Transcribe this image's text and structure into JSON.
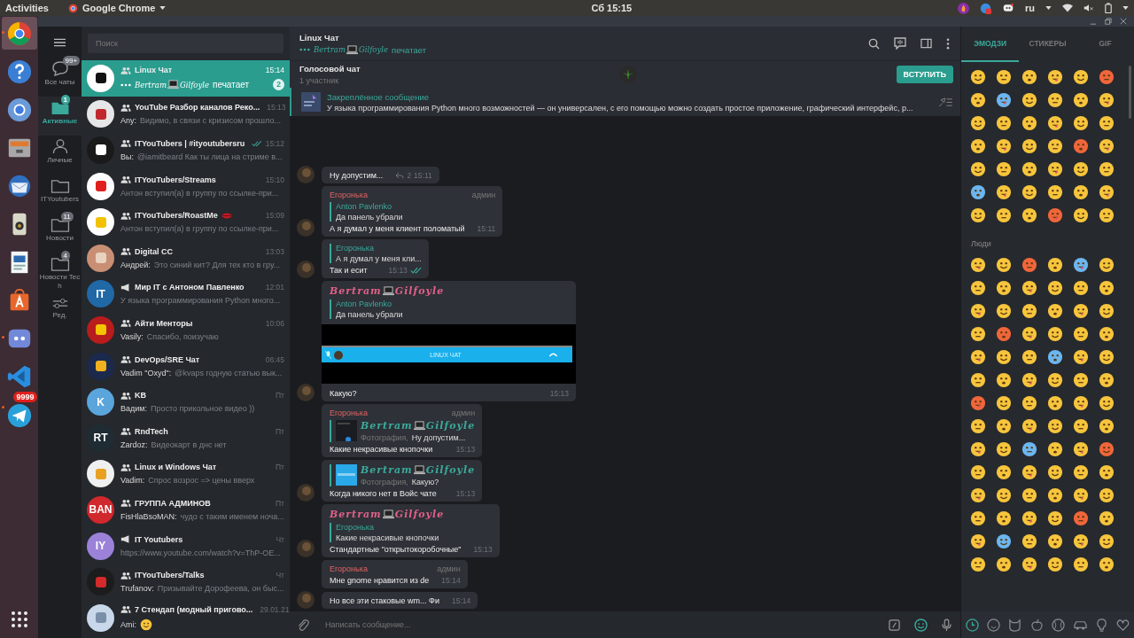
{
  "topbar": {
    "activities": "Activities",
    "app": "Google Chrome",
    "clock": "Сб 15:15",
    "lang": "ru"
  },
  "dock": {
    "items": [
      {
        "kind": "chrome",
        "selected": true,
        "running": true
      },
      {
        "kind": "help",
        "selected": false,
        "running": false
      },
      {
        "kind": "chromium",
        "selected": false,
        "running": false
      },
      {
        "kind": "files",
        "selected": false,
        "running": false
      },
      {
        "kind": "mail",
        "selected": false,
        "running": false
      },
      {
        "kind": "speaker",
        "selected": false,
        "running": false
      },
      {
        "kind": "writer",
        "selected": false,
        "running": false
      },
      {
        "kind": "store",
        "selected": false,
        "running": false
      },
      {
        "kind": "discord",
        "selected": false,
        "running": true
      },
      {
        "kind": "code",
        "selected": false,
        "running": false
      },
      {
        "kind": "telegram",
        "selected": false,
        "running": true,
        "badge": "9999"
      }
    ]
  },
  "folders": [
    {
      "kind": "chats",
      "label": "Все чаты",
      "badge": "99+",
      "selected": false
    },
    {
      "kind": "active",
      "label": "Активные",
      "badge": "1",
      "selected": true
    },
    {
      "kind": "person",
      "label": "Личные",
      "selected": false
    },
    {
      "kind": "folder",
      "label": "ITYoutubers",
      "selected": false
    },
    {
      "kind": "folder",
      "label": "Новости",
      "badge": "11",
      "selected": false
    },
    {
      "kind": "folder",
      "label": "Новости Tech",
      "badge": "4",
      "selected": false
    },
    {
      "kind": "edit",
      "label": "Ред.",
      "selected": false
    }
  ],
  "search": {
    "placeholder": "Поиск"
  },
  "chats": [
    {
      "kind": "group",
      "name": "Linux Чат",
      "time": "15:14",
      "selected": true,
      "read": false,
      "unread": "2",
      "avatar": {
        "color": "#ffffff",
        "emblem": {
          "color": "#111111"
        }
      },
      "typing": {
        "name_parts": [
          "Bertram",
          "Gilfoyle"
        ],
        "text": "печатает"
      }
    },
    {
      "kind": "group",
      "name": "YouTube Разбор каналов Реко...",
      "time": "15:13",
      "selected": false,
      "read": false,
      "avatar": {
        "color": "#e6e6e6",
        "emblem": {
          "color": "#c0282d"
        }
      },
      "sender": "Any:",
      "preview": "Видимо, в связи с кризисом прошло..."
    },
    {
      "kind": "group",
      "name": "ITYouTubers | #ityoutubersru",
      "time": "15:12",
      "selected": false,
      "read": true,
      "avatar": {
        "color": "#1a1a1a",
        "emblem": {
          "color": "#ffffff"
        }
      },
      "sender": "Вы:",
      "preview": "@iamitbeard Как  ты лица на стриме в..."
    },
    {
      "kind": "group",
      "name": "ITYouTubers/Streams",
      "time": "15:10",
      "selected": false,
      "read": false,
      "avatar": {
        "color": "#ffffff",
        "emblem": {
          "color": "#e0201c"
        }
      },
      "preview": "Антон вступил(а) в группу по ссылке-при..."
    },
    {
      "kind": "group",
      "name": "ITYouTubers/RoastMe",
      "time": "15:09",
      "selected": false,
      "read": false,
      "name_emoji": {
        "kind": "lips"
      },
      "avatar": {
        "color": "#ffffff",
        "emblem": {
          "color": "#f2c200"
        }
      },
      "preview": "Антон вступил(а) в группу по ссылке-при..."
    },
    {
      "kind": "group",
      "name": "Digital CC",
      "time": "13:03",
      "selected": false,
      "read": false,
      "avatar": {
        "color": "#c98f74",
        "emblem": {
          "color": "#e8d2c0"
        }
      },
      "sender": "Андрей:",
      "preview": "Это синий кит? Для тех кто в гру..."
    },
    {
      "kind": "channel",
      "name": "Мир IT с Антоном Павленко",
      "time": "12:01",
      "selected": false,
      "read": false,
      "avatar": {
        "color": "#2168a6",
        "letters": "IT"
      },
      "preview": "У языка программирования Python много..."
    },
    {
      "kind": "group",
      "name": "Айти Менторы",
      "time": "10:06",
      "selected": false,
      "read": false,
      "avatar": {
        "color": "#b81c1c",
        "emblem": {
          "color": "#f5c400"
        }
      },
      "sender": "Vasily:",
      "preview": "Спасибо, поизучаю"
    },
    {
      "kind": "group",
      "name": "DevOps/SRE Чат",
      "time": "06:45",
      "selected": false,
      "read": false,
      "avatar": {
        "color": "#1b2a4c",
        "emblem": {
          "color": "#f0b020"
        }
      },
      "sender": "Vadim \"Oxyd\":",
      "preview": "@kvaps годную статью вык..."
    },
    {
      "kind": "group",
      "name": "KB",
      "time": "Пт",
      "selected": false,
      "read": false,
      "avatar": {
        "color": "#5aa5dc",
        "letters": "K"
      },
      "sender": "Вадим:",
      "preview": "Просто прикольное видео ))"
    },
    {
      "kind": "group",
      "name": "RndTech",
      "time": "Пт",
      "selected": false,
      "read": false,
      "avatar": {
        "color": "#1f2c33",
        "letters": "RT"
      },
      "sender": "Zardoz:",
      "preview": "Видеокарт в днс нет"
    },
    {
      "kind": "group",
      "name": "Linux и Windows Чат",
      "time": "Пт",
      "selected": false,
      "read": false,
      "avatar": {
        "color": "#f0f0f0",
        "emblem": {
          "color": "#e8a020"
        }
      },
      "sender": "Vadim:",
      "preview": "Спрос возрос => цены вверх"
    },
    {
      "kind": "group",
      "name": "ГРУППА АДМИНОВ",
      "time": "Пт",
      "selected": false,
      "read": false,
      "avatar": {
        "color": "#d0282c",
        "letters": "BAN"
      },
      "sender": "FisHlaBsoMAN:",
      "preview": "чудо с таким именем ноча..."
    },
    {
      "kind": "channel",
      "name": "IT Youtubers",
      "time": "Чт",
      "selected": false,
      "read": false,
      "avatar": {
        "color": "#9b82d8",
        "letters": "IY"
      },
      "preview": "https://www.youtube.com/watch?v=ThP-OE..."
    },
    {
      "kind": "group",
      "name": "ITYouTubers/Talks",
      "time": "Чт",
      "selected": false,
      "read": false,
      "avatar": {
        "color": "#1c1c1c",
        "emblem": {
          "color": "#d42a2a"
        }
      },
      "sender": "Trufanov:",
      "preview": "Призывайте Дорофеева, он быс..."
    },
    {
      "kind": "group",
      "name": "7 Стендап (модный пригово...",
      "time": "29.01.21",
      "selected": false,
      "read": false,
      "avatar": {
        "color": "#c8d8ea",
        "emblem": {
          "color": "#7a8fa8"
        }
      },
      "sender": "Ami:",
      "preview_emoji": {
        "kind": "laughing"
      }
    }
  ],
  "header": {
    "title": "Linux Чат",
    "typing": {
      "name_parts": [
        "Bertram",
        "Gilfoyle"
      ],
      "text": "печатает"
    }
  },
  "voice": {
    "title": "Голосовой чат",
    "count": "1 участник",
    "button": "ВСТУПИТЬ"
  },
  "pinned": {
    "title": "Закреплённое сообщение",
    "text": "У языка программирования Python много возможностей — он универсален, с его помощью можно создать простое приложение, графический интерфейс, р..."
  },
  "messages": [
    {
      "avatar": true,
      "text": "Ну допустим...",
      "replies": "2",
      "time": "15:11"
    },
    {
      "avatar": true,
      "sender": {
        "kind": "plain",
        "name": "Егоронька",
        "badge": "админ"
      },
      "reply": {
        "kind": "plain",
        "name": "Anton Pavlenko",
        "text": "Да панель убрали"
      },
      "text": "А я думал у меня клиент поломатый",
      "time": "15:11"
    },
    {
      "avatar": true,
      "reply": {
        "kind": "plain",
        "name": "Егоронька",
        "text": "А я думал у меня кли..."
      },
      "text": "Так и есит",
      "time": "15:13",
      "read": true
    },
    {
      "avatar": true,
      "sender": {
        "kind": "fancy",
        "name_parts": [
          "Bertram",
          "Gilfoyle"
        ]
      },
      "reply": {
        "kind": "plain",
        "name": "Anton Pavlenko",
        "text": "Да панель убрали"
      },
      "image": {
        "kind": "screenshot",
        "title": "LINUX ЧАТ"
      },
      "text": "Какую?",
      "time": "15:13"
    },
    {
      "avatar": false,
      "sender": {
        "kind": "plain",
        "name": "Егоронька",
        "badge": "админ"
      },
      "reply": {
        "kind": "fancy",
        "name_parts": [
          "Bertram",
          "Gilfoyle"
        ],
        "media": "Фотография,",
        "text": "Ну допустим...",
        "thumb": {
          "kind": "dark"
        }
      },
      "text": "Какие некрасивые кнопочки",
      "time": "15:13"
    },
    {
      "avatar": true,
      "reply": {
        "kind": "fancy",
        "name_parts": [
          "Bertram",
          "Gilfoyle"
        ],
        "media": "Фотография,",
        "text": "Какую?",
        "thumb": {
          "kind": "blue"
        }
      },
      "text": "Когда никого нет в Войс чате",
      "time": "15:13"
    },
    {
      "avatar": true,
      "sender": {
        "kind": "fancy",
        "name_parts": [
          "Bertram",
          "Gilfoyle"
        ]
      },
      "reply": {
        "kind": "plain",
        "name": "Егоронька",
        "text": "Какие некрасивые кнопочки"
      },
      "text": "Стандартные \"открытокоробочные\"",
      "time": "15:13"
    },
    {
      "avatar": false,
      "sender": {
        "kind": "plain",
        "name": "Егоронька",
        "badge": "админ"
      },
      "text": "Мне gnome нравится из de",
      "time": "15:14"
    },
    {
      "avatar": true,
      "text": "Но все эти стаковые wm... Фи",
      "time": "15:14"
    }
  ],
  "composer": {
    "placeholder": "Написать сообщение..."
  },
  "emoji_panel": {
    "tabs": [
      {
        "label": "ЭМОДЗИ",
        "selected": true
      },
      {
        "label": "СТИКЕРЫ",
        "selected": false
      },
      {
        "label": "GIF",
        "selected": false
      }
    ],
    "section": "Люди",
    "categories": [
      {
        "kind": "clock",
        "selected": true
      },
      {
        "kind": "smile",
        "selected": false
      },
      {
        "kind": "cat",
        "selected": false
      },
      {
        "kind": "apple",
        "selected": false
      },
      {
        "kind": "ball",
        "selected": false
      },
      {
        "kind": "car",
        "selected": false
      },
      {
        "kind": "bulb",
        "selected": false
      },
      {
        "kind": "heart",
        "selected": false
      }
    ]
  }
}
